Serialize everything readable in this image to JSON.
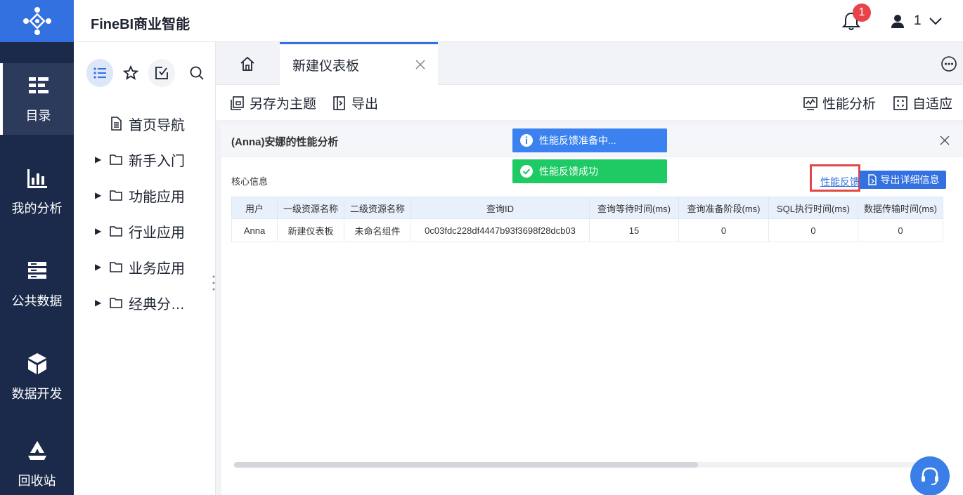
{
  "header": {
    "app_title": "FineBI商业智能",
    "notification_count": "1",
    "user_name": "1"
  },
  "leftnav": {
    "items": [
      {
        "label": "目录",
        "icon": "catalog-icon",
        "active": true
      },
      {
        "label": "我的分析",
        "icon": "chart-icon"
      },
      {
        "label": "公共数据",
        "icon": "database-icon"
      },
      {
        "label": "数据开发",
        "icon": "cube-icon"
      },
      {
        "label": "回收站",
        "icon": "recycle-icon"
      }
    ]
  },
  "directory": {
    "tabs": [
      "list-icon",
      "star-icon",
      "share-icon",
      "search-icon"
    ],
    "items": [
      {
        "label": "首页导航",
        "type": "file"
      },
      {
        "label": "新手入门",
        "type": "folder"
      },
      {
        "label": "功能应用",
        "type": "folder"
      },
      {
        "label": "行业应用",
        "type": "folder"
      },
      {
        "label": "业务应用",
        "type": "folder"
      },
      {
        "label": "经典分…",
        "type": "folder"
      }
    ]
  },
  "tabs": {
    "active_tab": "新建仪表板"
  },
  "toolbar": {
    "save_as_theme": "另存为主题",
    "export": "导出",
    "performance_analysis": "性能分析",
    "adaptive": "自适应"
  },
  "dialog": {
    "title": "(Anna)安娜的性能分析",
    "core_info": "核心信息",
    "feedback_link": "性能反馈",
    "export_details": "导出详细信息",
    "toast_info": "性能反馈准备中...",
    "toast_success": "性能反馈成功",
    "table": {
      "headers": [
        "用户",
        "一级资源名称",
        "二级资源名称",
        "查询ID",
        "查询等待时间(ms)",
        "查询准备阶段(ms)",
        "SQL执行时间(ms)",
        "数据传输时间(ms)"
      ],
      "rows": [
        [
          "Anna",
          "新建仪表板",
          "未命名组件",
          "0c03fdc228df4447b93f3698f28dcb03",
          "15",
          "0",
          "0",
          "0"
        ]
      ]
    }
  },
  "colors": {
    "accent": "#3370e0",
    "nav_bg": "#1b2a4a",
    "success": "#1dca63",
    "highlight": "#e34848"
  }
}
